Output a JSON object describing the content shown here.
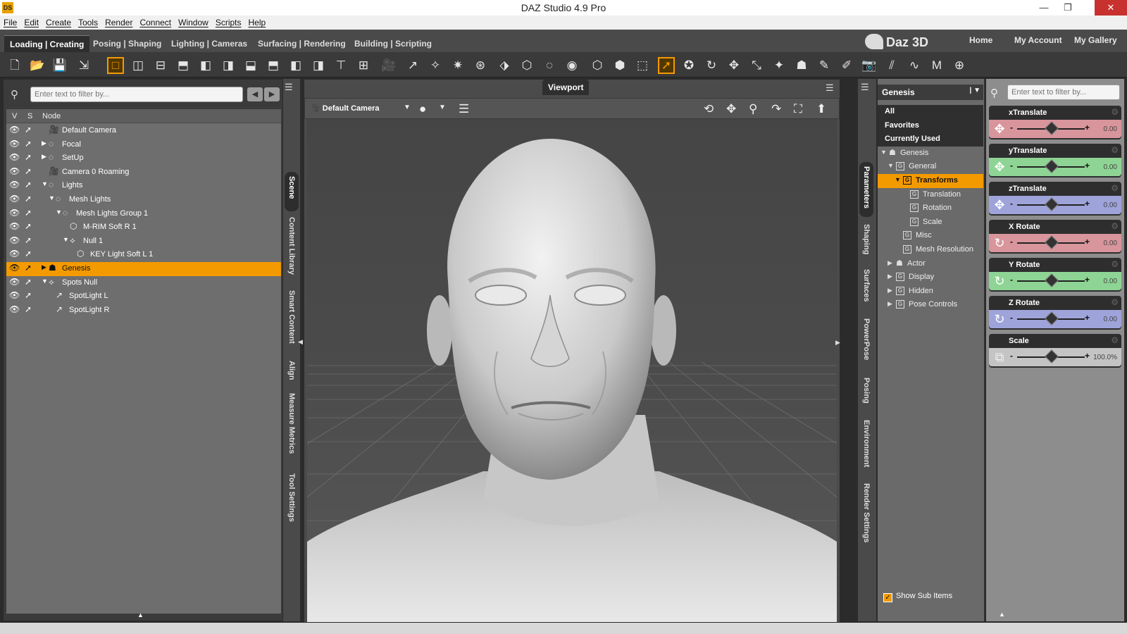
{
  "app": {
    "title": "DAZ Studio 4.9 Pro",
    "icon_text": "DS"
  },
  "menu": [
    "File",
    "Edit",
    "Create",
    "Tools",
    "Render",
    "Connect",
    "Window",
    "Scripts",
    "Help"
  ],
  "workspace_tabs": [
    "Loading | Creating",
    "Posing | Shaping",
    "Lighting | Cameras",
    "Surfacing | Rendering",
    "Building | Scripting"
  ],
  "brand": {
    "logo": "Daz 3D",
    "links": [
      "Home",
      "My Account",
      "My Gallery"
    ]
  },
  "scene": {
    "search_placeholder": "Enter text to filter by...",
    "columns": [
      "V",
      "S",
      "Node"
    ],
    "nodes": [
      {
        "label": "Default Camera",
        "depth": 0,
        "icon": "camera-icon",
        "expand": "",
        "selected": false
      },
      {
        "label": "Focal",
        "depth": 0,
        "icon": "null-icon",
        "expand": "▶",
        "selected": false
      },
      {
        "label": "SetUp",
        "depth": 0,
        "icon": "null-icon",
        "expand": "▶",
        "selected": false
      },
      {
        "label": "Camera 0 Roaming",
        "depth": 0,
        "icon": "camera-icon",
        "expand": "",
        "selected": false
      },
      {
        "label": "Lights",
        "depth": 0,
        "icon": "null-icon",
        "expand": "▼",
        "selected": false
      },
      {
        "label": "Mesh Lights",
        "depth": 1,
        "icon": "null-icon",
        "expand": "▼",
        "selected": false
      },
      {
        "label": "Mesh Lights Group 1",
        "depth": 2,
        "icon": "null-icon",
        "expand": "▼",
        "selected": false
      },
      {
        "label": "M-RIM Soft R 1",
        "depth": 3,
        "icon": "mesh-icon",
        "expand": "",
        "selected": false
      },
      {
        "label": "Null 1",
        "depth": 3,
        "icon": "group-icon",
        "expand": "▼",
        "selected": false
      },
      {
        "label": "KEY Light Soft L 1",
        "depth": 4,
        "icon": "mesh-icon",
        "expand": "",
        "selected": false
      },
      {
        "label": "Genesis",
        "depth": 0,
        "icon": "figure-icon",
        "expand": "▶",
        "selected": true
      },
      {
        "label": "Spots Null",
        "depth": 0,
        "icon": "group-icon",
        "expand": "▼",
        "selected": false
      },
      {
        "label": "SpotLight L",
        "depth": 1,
        "icon": "spotlight-icon",
        "expand": "",
        "selected": false
      },
      {
        "label": "SpotLight R",
        "depth": 1,
        "icon": "spotlight-icon",
        "expand": "",
        "selected": false
      }
    ]
  },
  "left_side_tabs": [
    "Scene",
    "Content Library",
    "Smart Content",
    "Align",
    "Measure Metrics",
    "Tool Settings"
  ],
  "viewport": {
    "label": "Viewport",
    "camera": "Default Camera"
  },
  "right_side_tabs": [
    "Parameters",
    "Shaping",
    "Surfaces",
    "PowerPose",
    "Posing",
    "Environment",
    "Render Settings"
  ],
  "parameters": {
    "node": "Genesis",
    "tree": [
      {
        "label": "All",
        "type": "cat",
        "depth": 0,
        "expand": ""
      },
      {
        "label": "Favorites",
        "type": "cat",
        "depth": 0,
        "expand": ""
      },
      {
        "label": "Currently Used",
        "type": "cat",
        "depth": 0,
        "expand": ""
      },
      {
        "label": "Genesis",
        "type": "node",
        "depth": 0,
        "expand": "▼"
      },
      {
        "label": "General",
        "type": "group",
        "depth": 1,
        "expand": "▼"
      },
      {
        "label": "Transforms",
        "type": "sel",
        "depth": 2,
        "expand": "▼"
      },
      {
        "label": "Translation",
        "type": "group",
        "depth": 3,
        "expand": ""
      },
      {
        "label": "Rotation",
        "type": "group",
        "depth": 3,
        "expand": ""
      },
      {
        "label": "Scale",
        "type": "group",
        "depth": 3,
        "expand": ""
      },
      {
        "label": "Misc",
        "type": "group",
        "depth": 2,
        "expand": ""
      },
      {
        "label": "Mesh Resolution",
        "type": "group",
        "depth": 2,
        "expand": ""
      },
      {
        "label": "Actor",
        "type": "node",
        "depth": 1,
        "expand": "▶"
      },
      {
        "label": "Display",
        "type": "group",
        "depth": 1,
        "expand": "▶"
      },
      {
        "label": "Hidden",
        "type": "group",
        "depth": 1,
        "expand": "▶"
      },
      {
        "label": "Pose Controls",
        "type": "group",
        "depth": 1,
        "expand": "▶"
      }
    ],
    "show_sub_items": "Show Sub Items",
    "search_placeholder": "Enter text to filter by...",
    "sliders": [
      {
        "name": "xTranslate",
        "value": "0.00",
        "color": "#d8959b",
        "icon": "move-icon"
      },
      {
        "name": "yTranslate",
        "value": "0.00",
        "color": "#8ed494",
        "icon": "move-icon"
      },
      {
        "name": "zTranslate",
        "value": "0.00",
        "color": "#9ea3da",
        "icon": "move-icon"
      },
      {
        "name": "X Rotate",
        "value": "0.00",
        "color": "#d8959b",
        "icon": "rotate-icon"
      },
      {
        "name": "Y Rotate",
        "value": "0.00",
        "color": "#8ed494",
        "icon": "rotate-icon"
      },
      {
        "name": "Z Rotate",
        "value": "0.00",
        "color": "#9ea3da",
        "icon": "rotate-icon"
      },
      {
        "name": "Scale",
        "value": "100.0%",
        "color": "#c4c4c4",
        "icon": "scale-icon"
      }
    ]
  },
  "colors": {
    "accent": "#f39a00"
  }
}
